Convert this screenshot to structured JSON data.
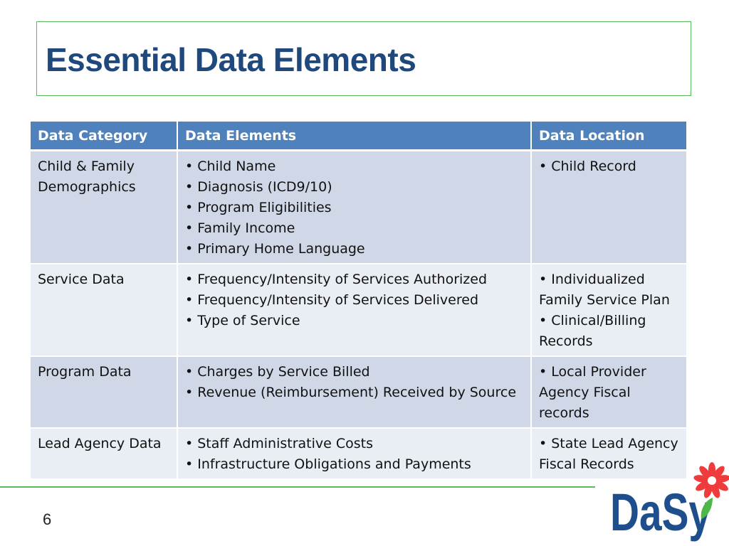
{
  "slide": {
    "title": "Essential Data Elements",
    "page_number": "6",
    "logo_text": "DaSy",
    "colors": {
      "title": "#1f497d",
      "header_bg": "#4f81bd",
      "row_odd": "#d0d8e8",
      "row_even": "#e9edf4",
      "accent_line": "#5cb85c",
      "flower": "#ef3b3b",
      "leaf": "#4cb848"
    }
  },
  "table": {
    "headers": [
      "Data Category",
      "Data Elements",
      "Data Location"
    ],
    "rows": [
      {
        "category": "Child & Family Demographics",
        "elements": [
          "Child Name",
          "Diagnosis (ICD9/10)",
          "Program Eligibilities",
          "Family Income",
          "Primary Home Language"
        ],
        "locations": [
          "Child Record"
        ]
      },
      {
        "category": "Service Data",
        "elements": [
          "Frequency/Intensity of Services Authorized",
          "Frequency/Intensity of Services Delivered",
          "Type of Service"
        ],
        "locations": [
          "Individualized Family Service Plan",
          "Clinical/Billing Records"
        ]
      },
      {
        "category": "Program Data",
        "elements": [
          "Charges by Service Billed",
          "Revenue (Reimbursement) Received by Source"
        ],
        "locations": [
          "Local Provider Agency Fiscal records"
        ]
      },
      {
        "category": "Lead Agency Data",
        "elements": [
          "Staff Administrative Costs",
          "Infrastructure Obligations and Payments"
        ],
        "locations": [
          "State Lead Agency Fiscal Records"
        ]
      }
    ]
  }
}
